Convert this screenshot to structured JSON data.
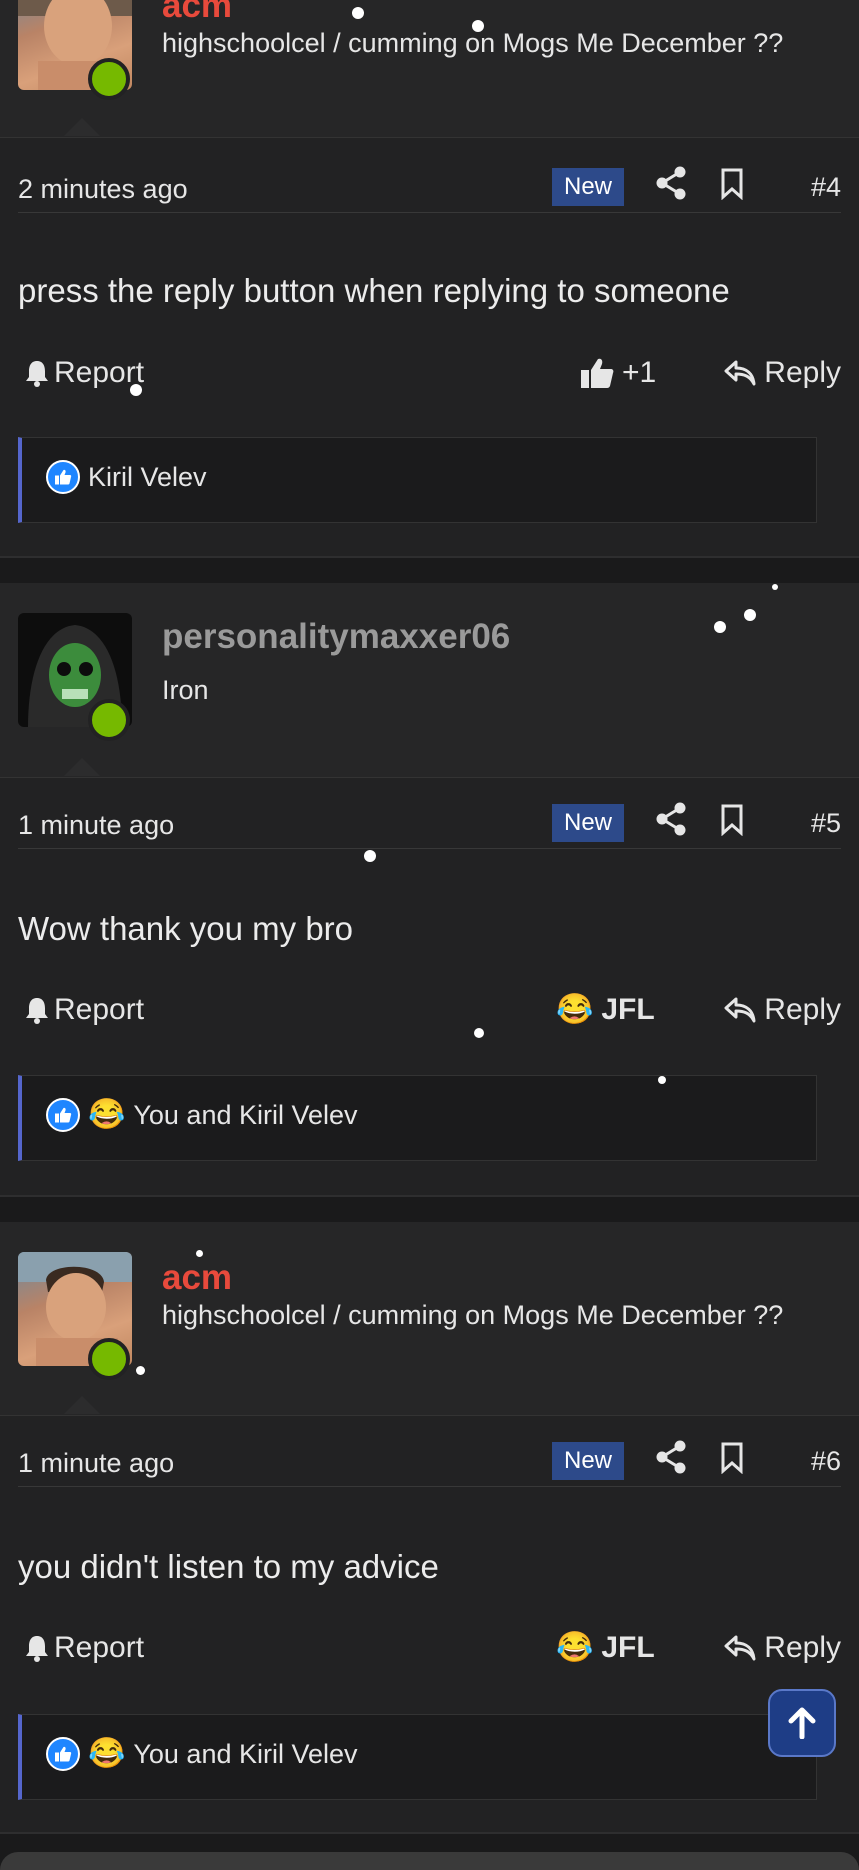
{
  "posts": [
    {
      "username": "acm",
      "user_title": "highschoolcel / cumming on Mogs Me December ??",
      "time": "2 minutes ago",
      "badge": "New",
      "number": "#4",
      "message": "press the reply button when replying to someone",
      "report_label": "Report",
      "reaction_label": "+1",
      "reply_label": "Reply",
      "reactions_text": "Kiril Velev"
    },
    {
      "username": "personalitymaxxer06",
      "user_title": "Iron",
      "time": "1 minute ago",
      "badge": "New",
      "number": "#5",
      "message": "Wow thank you my bro",
      "report_label": "Report",
      "reaction_label": "JFL",
      "reply_label": "Reply",
      "reactions_text": "You and Kiril Velev"
    },
    {
      "username": "acm",
      "user_title": "highschoolcel / cumming on Mogs Me December ??",
      "time": "1 minute ago",
      "badge": "New",
      "number": "#6",
      "message": "you didn't listen to my advice",
      "report_label": "Report",
      "reaction_label": "JFL",
      "reply_label": "Reply",
      "reactions_text": "You and Kiril Velev"
    }
  ],
  "colors": {
    "background": "#1a1a1b",
    "accent": "#2d4a8a",
    "username_red": "#e84a3c",
    "username_gray": "#9a9a9a",
    "online": "#76b900",
    "reaction_border": "#5566cc"
  },
  "icons": [
    "share-icon",
    "bookmark-icon",
    "bell-icon",
    "thumbs-up-icon",
    "reply-arrow-icon",
    "laughing-emoji-icon",
    "arrow-up-icon"
  ]
}
